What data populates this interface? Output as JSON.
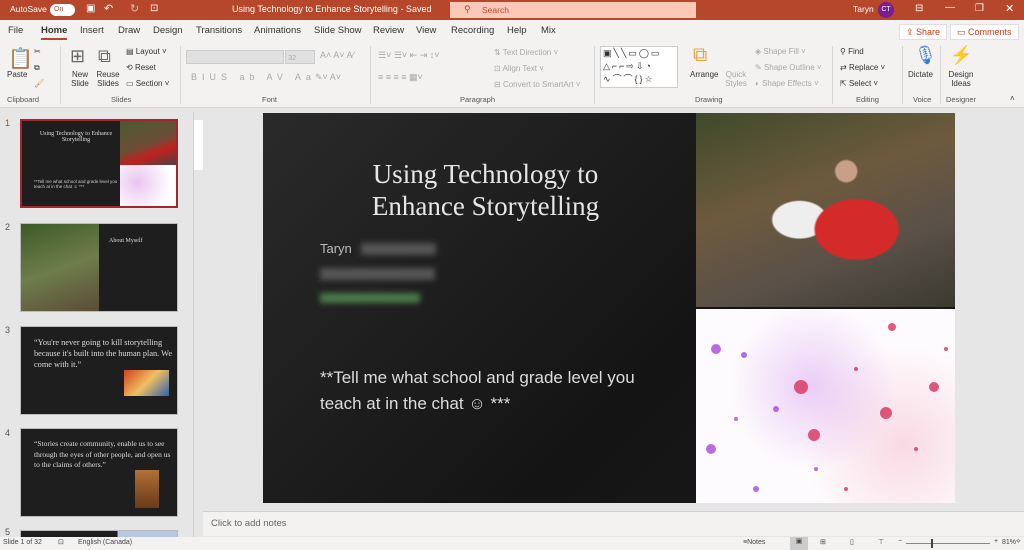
{
  "titlebar": {
    "autosave_label": "AutoSave",
    "autosave_state": "On",
    "doc_title": "Using Technology to Enhance Storytelling  -  Saved",
    "search_placeholder": "Search",
    "user_name": "Taryn",
    "user_initials": "CT",
    "accent": "#b7472a"
  },
  "tabs": [
    "File",
    "Home",
    "Insert",
    "Draw",
    "Design",
    "Transitions",
    "Animations",
    "Slide Show",
    "Review",
    "View",
    "Recording",
    "Help",
    "Mix"
  ],
  "active_tab": "Home",
  "actions": {
    "share": "Share",
    "comments": "Comments"
  },
  "ribbon": {
    "clipboard": {
      "label": "Clipboard",
      "paste": "Paste"
    },
    "slides": {
      "label": "Slides",
      "new_slide": "New Slide",
      "reuse_slides": "Reuse Slides",
      "layout": "Layout",
      "reset": "Reset",
      "section": "Section"
    },
    "font": {
      "label": "Font",
      "size": "32"
    },
    "paragraph": {
      "label": "Paragraph",
      "text_direction": "Text Direction",
      "align_text": "Align Text",
      "convert_smartart": "Convert to SmartArt"
    },
    "drawing": {
      "label": "Drawing",
      "arrange": "Arrange",
      "quick_styles": "Quick Styles",
      "shape_fill": "Shape Fill",
      "shape_outline": "Shape Outline",
      "shape_effects": "Shape Effects"
    },
    "editing": {
      "label": "Editing",
      "find": "Find",
      "replace": "Replace",
      "select": "Select"
    },
    "voice": {
      "label": "Voice",
      "dictate": "Dictate"
    },
    "designer": {
      "label": "Designer",
      "design_ideas": "Design Ideas"
    }
  },
  "thumbnails": [
    {
      "num": "1",
      "title": "Using Technology to Enhance Storytelling",
      "body": "**Tell me what school and grade level you teach at in the chat ☺ ***"
    },
    {
      "num": "2",
      "title": "About Myself"
    },
    {
      "num": "3",
      "quote": "“You're never going to kill storytelling because it's built into the human plan. We come with it.”"
    },
    {
      "num": "4",
      "quote": "“Stories create community, enable us to see through the eyes of other people, and open us to the claims of others.”"
    },
    {
      "num": "5"
    }
  ],
  "slide": {
    "title": "Using Technology to Enhance Storytelling",
    "name": "Taryn",
    "prompt": "**Tell me what school and grade level you teach at in the chat ☺ ***"
  },
  "notes_placeholder": "Click to add notes",
  "status": {
    "slide_of": "Slide 1 of 32",
    "language": "English (Canada)",
    "notes": "Notes",
    "zoom": "81%"
  }
}
